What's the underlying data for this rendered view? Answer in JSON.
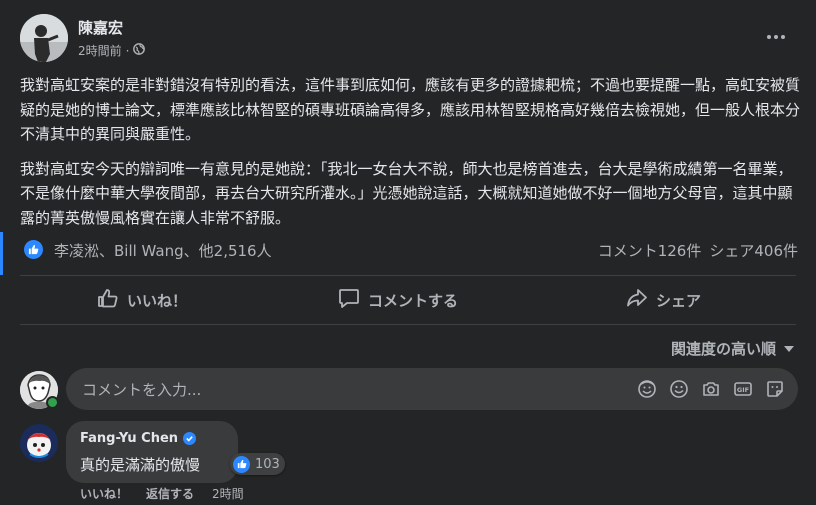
{
  "post": {
    "author": "陳嘉宏",
    "time": "2時間前",
    "separator": "·",
    "paragraphs": [
      "我對高虹安案的是非對錯沒有特別的看法，這件事到底如何，應該有更多的證據耙梳；不過也要提醒一點，高虹安被質疑的是她的博士論文，標準應該比林智堅的碩專班碩論高得多，應該用林智堅規格高好幾倍去檢視她，但一般人根本分不清其中的異同與嚴重性。",
      "我對高虹安今天的辯詞唯一有意見的是她說：「我北一女台大不說，師大也是榜首進去，台大是學術成績第一名畢業，不是像什麼中華大學夜間部，再去台大研究所灌水。」光憑她說這話，大概就知道她做不好一個地方父母官，這其中顯露的菁英傲慢風格實在讓人非常不舒服。"
    ],
    "reactors": "李凌淞、Bill Wang、他2,516人",
    "comments_count": "コメント126件",
    "shares_count": "シェア406件"
  },
  "actions": {
    "like": "いいね！",
    "comment": "コメントする",
    "share": "シェア"
  },
  "sort": {
    "label": "関連度の高い順"
  },
  "composer": {
    "placeholder": "コメントを入力..."
  },
  "comment": {
    "author": "Fang-Yu Chen",
    "text": "真的是滿滿的傲慢",
    "reaction_count": "103",
    "like": "いいね！",
    "reply": "返信する",
    "time": "2時間"
  },
  "icons": [
    "public-globe-icon",
    "more-icon",
    "like-icon",
    "comment-icon",
    "share-icon",
    "avatar-sticker-icon",
    "emoji-icon",
    "camera-icon",
    "gif-icon",
    "sticker-icon",
    "verified-icon"
  ],
  "colors": {
    "background": "#242526",
    "bubble": "#3a3b3c",
    "accent": "#2d88ff",
    "secondary_text": "#b0b3b8",
    "online": "#31a24c"
  }
}
